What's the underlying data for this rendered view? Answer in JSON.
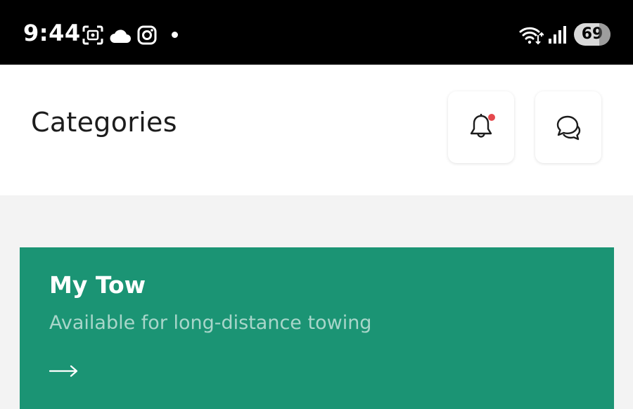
{
  "status_bar": {
    "time": "9:44",
    "battery": "69",
    "icons": [
      "screenshot-icon",
      "cloud-icon",
      "instagram-icon",
      "notification-dot",
      "wifi-icon",
      "signal-icon",
      "battery-icon"
    ]
  },
  "header": {
    "title": "Categories",
    "notification_icon": "bell-icon",
    "chat_icon": "chat-bubbles-icon",
    "notification_badge_color": "#e5484d"
  },
  "categories": [
    {
      "title": "My Tow",
      "subtitle": "Available for long-distance towing",
      "arrow_icon": "arrow-right-icon",
      "color": "#1b9474"
    }
  ]
}
